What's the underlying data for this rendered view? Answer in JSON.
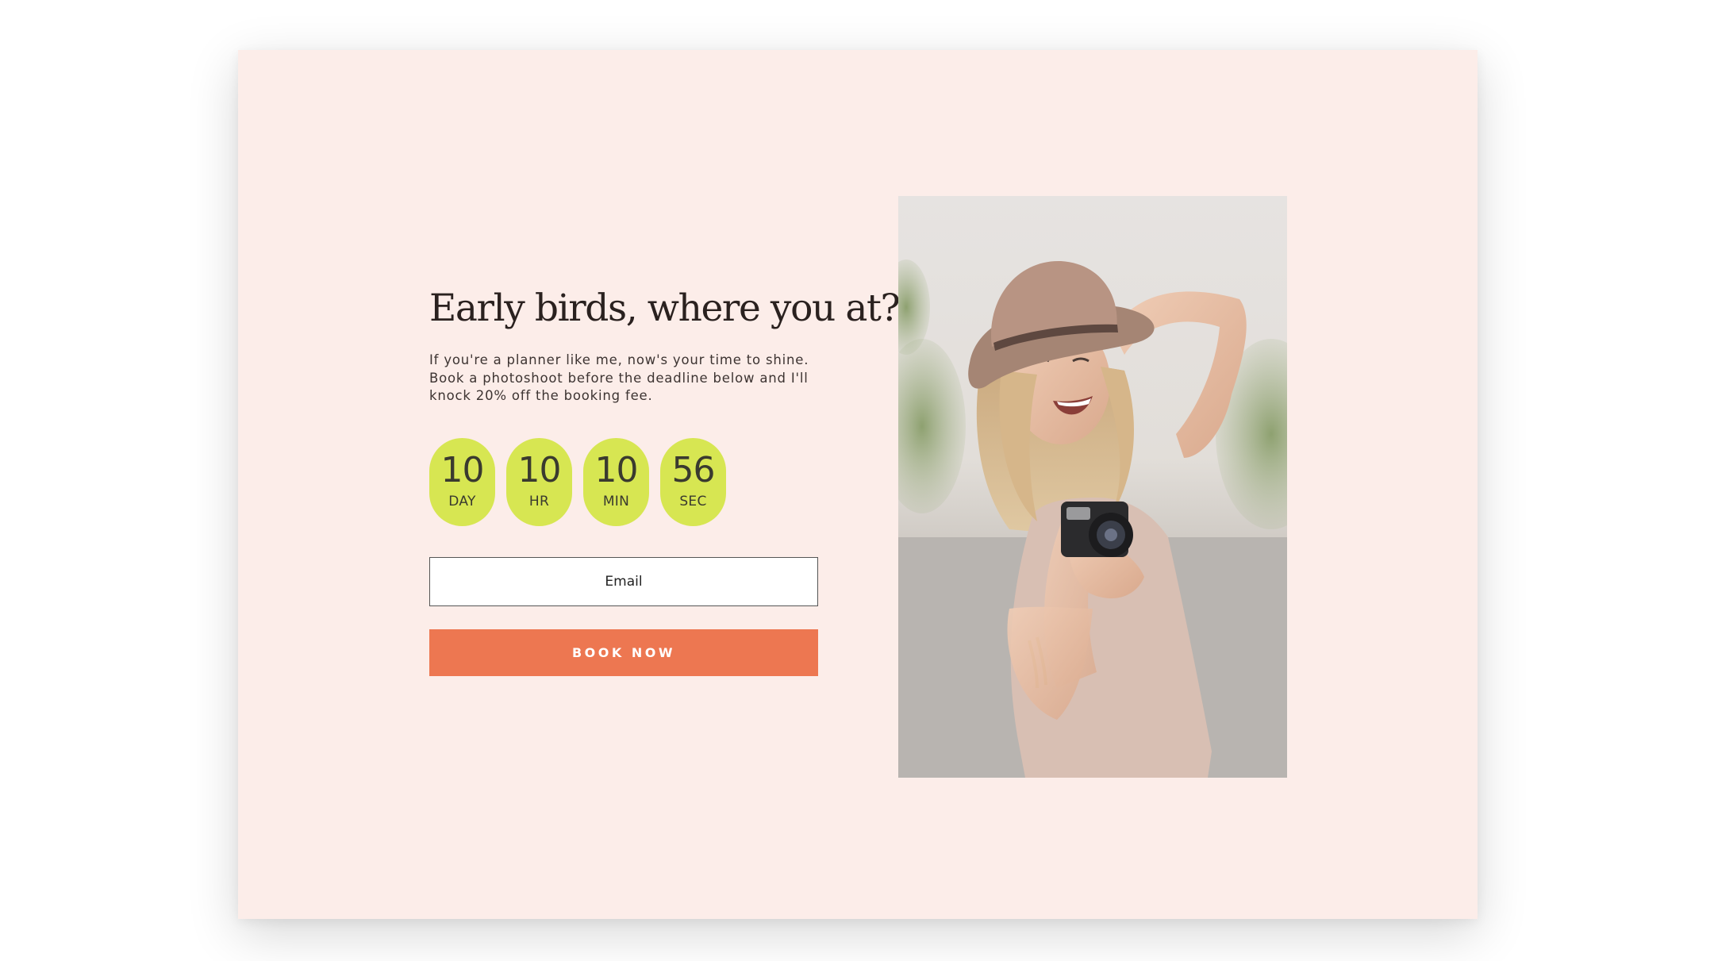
{
  "hero": {
    "headline": "Early birds, where you at?",
    "subtext": "If you're a planner like me, now's your time to shine. Book a photoshoot before the deadline below and I'll knock 20% off the booking fee."
  },
  "countdown": [
    {
      "value": "10",
      "unit": "DAY"
    },
    {
      "value": "10",
      "unit": "HR"
    },
    {
      "value": "10",
      "unit": "MIN"
    },
    {
      "value": "56",
      "unit": "SEC"
    }
  ],
  "form": {
    "email_placeholder": "Email",
    "button_label": "BOOK NOW"
  },
  "colors": {
    "background": "#fcede9",
    "pill": "#d7e652",
    "button": "#ed7751"
  }
}
